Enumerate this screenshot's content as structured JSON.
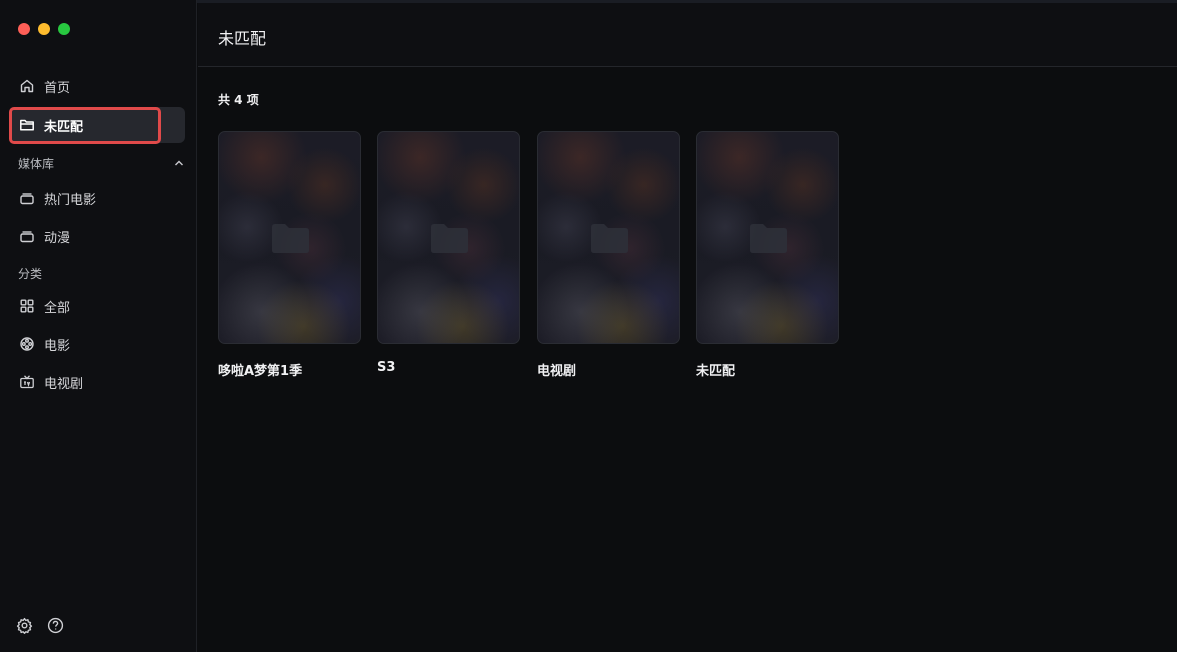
{
  "sidebar": {
    "nav": [
      {
        "label": "首页",
        "icon": "home-icon"
      },
      {
        "label": "未匹配",
        "icon": "folder-icon",
        "active": true
      }
    ],
    "library_section": "媒体库",
    "library_items": [
      {
        "label": "热门电影",
        "icon": "library-icon"
      },
      {
        "label": "动漫",
        "icon": "library-icon"
      }
    ],
    "category_section": "分类",
    "category_items": [
      {
        "label": "全部",
        "icon": "grid-icon"
      },
      {
        "label": "电影",
        "icon": "film-reel-icon"
      },
      {
        "label": "电视剧",
        "icon": "tv-icon"
      }
    ]
  },
  "header": {
    "title": "未匹配"
  },
  "content": {
    "count_label": "共 4 项",
    "items": [
      {
        "title": "哆啦A梦第1季"
      },
      {
        "title": "S3"
      },
      {
        "title": "电视剧"
      },
      {
        "title": "未匹配"
      }
    ]
  },
  "colors": {
    "highlight": "#e04a4a",
    "background": "#0c0d0f"
  }
}
